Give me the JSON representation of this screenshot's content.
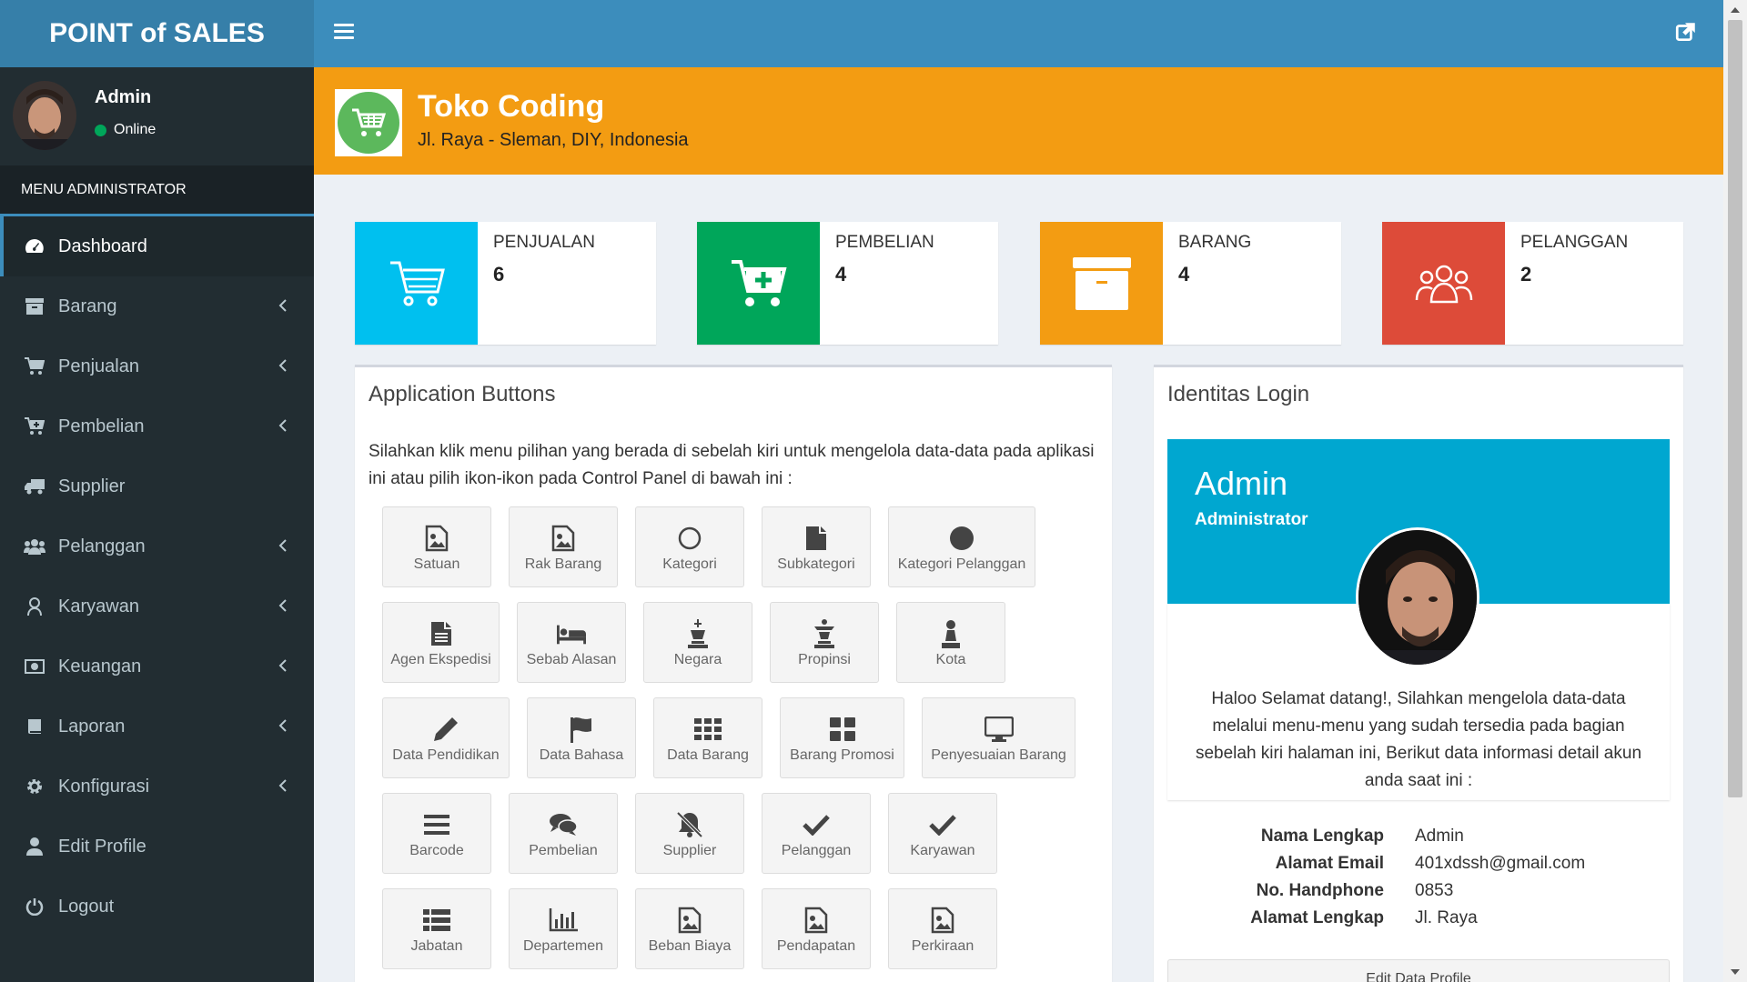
{
  "header": {
    "logo_text": "POINT of SALES"
  },
  "user": {
    "name": "Admin",
    "status": "Online"
  },
  "sidebar": {
    "header": "MENU ADMINISTRATOR",
    "items": [
      {
        "label": "Dashboard",
        "icon": "dashboard-icon",
        "has_chevron": false,
        "active": true
      },
      {
        "label": "Barang",
        "icon": "archive-icon",
        "has_chevron": true
      },
      {
        "label": "Penjualan",
        "icon": "cart-icon",
        "has_chevron": true
      },
      {
        "label": "Pembelian",
        "icon": "cart-plus-icon",
        "has_chevron": true
      },
      {
        "label": "Supplier",
        "icon": "truck-icon",
        "has_chevron": false
      },
      {
        "label": "Pelanggan",
        "icon": "users-icon",
        "has_chevron": true
      },
      {
        "label": "Karyawan",
        "icon": "user-secret-icon",
        "has_chevron": true
      },
      {
        "label": "Keuangan",
        "icon": "money-icon",
        "has_chevron": true
      },
      {
        "label": "Laporan",
        "icon": "book-icon",
        "has_chevron": true
      },
      {
        "label": "Konfigurasi",
        "icon": "gear-icon",
        "has_chevron": true
      },
      {
        "label": "Edit Profile",
        "icon": "user-icon",
        "has_chevron": false
      },
      {
        "label": "Logout",
        "icon": "power-icon",
        "has_chevron": false
      }
    ]
  },
  "store": {
    "name": "Toko Coding",
    "address": "Jl. Raya - Sleman, DIY, Indonesia"
  },
  "info_boxes": [
    {
      "label": "PENJUALAN",
      "value": "6",
      "color": "#00c0ef"
    },
    {
      "label": "PEMBELIAN",
      "value": "4",
      "color": "#00a65a"
    },
    {
      "label": "BARANG",
      "value": "4",
      "color": "#f39c12"
    },
    {
      "label": "PELANGGAN",
      "value": "2",
      "color": "#dd4b39"
    }
  ],
  "app_panel": {
    "title": "Application Buttons",
    "description": "Silahkan klik menu pilihan yang berada di sebelah kiri untuk mengelola data-data pada aplikasi ini atau pilih ikon-ikon pada Control Panel di bawah ini :",
    "buttons": [
      {
        "label": "Satuan",
        "icon": "image-icon"
      },
      {
        "label": "Rak Barang",
        "icon": "image-icon"
      },
      {
        "label": "Kategori",
        "icon": "circle-outline-icon"
      },
      {
        "label": "Subkategori",
        "icon": "file-icon"
      },
      {
        "label": "Kategori Pelanggan",
        "icon": "circle-icon"
      },
      {
        "label": "Agen Ekspedisi",
        "icon": "file-text-icon"
      },
      {
        "label": "Sebab Alasan",
        "icon": "bed-icon"
      },
      {
        "label": "Negara",
        "icon": "chess-king-icon"
      },
      {
        "label": "Propinsi",
        "icon": "chess-queen-icon"
      },
      {
        "label": "Kota",
        "icon": "chess-pawn-icon"
      },
      {
        "label": "Data Pendidikan",
        "icon": "pencil-icon"
      },
      {
        "label": "Data Bahasa",
        "icon": "flag-icon"
      },
      {
        "label": "Data Barang",
        "icon": "grid-icon"
      },
      {
        "label": "Barang Promosi",
        "icon": "th-large-icon"
      },
      {
        "label": "Penyesuaian Barang",
        "icon": "desktop-icon"
      },
      {
        "label": "Barcode",
        "icon": "bars-icon"
      },
      {
        "label": "Pembelian",
        "icon": "comments-icon"
      },
      {
        "label": "Supplier",
        "icon": "bell-slash-icon"
      },
      {
        "label": "Pelanggan",
        "icon": "check-icon"
      },
      {
        "label": "Karyawan",
        "icon": "check-icon"
      },
      {
        "label": "Jabatan",
        "icon": "list-icon"
      },
      {
        "label": "Departemen",
        "icon": "bar-chart-icon"
      },
      {
        "label": "Beban Biaya",
        "icon": "image-icon"
      },
      {
        "label": "Pendapatan",
        "icon": "image-icon"
      },
      {
        "label": "Perkiraan",
        "icon": "image-icon"
      }
    ]
  },
  "login_panel": {
    "title": "Identitas Login",
    "widget_name": "Admin",
    "widget_role": "Administrator",
    "message": "Haloo Selamat datang!, Silahkan mengelola data-data melalui menu-menu yang sudah tersedia pada bagian sebelah kiri halaman ini, Berikut data informasi detail akun anda saat ini :",
    "fields": [
      {
        "label": "Nama Lengkap",
        "value": "Admin"
      },
      {
        "label": "Alamat Email",
        "value": "401xdssh@gmail.com"
      },
      {
        "label": "No. Handphone",
        "value": "0853"
      },
      {
        "label": "Alamat Lengkap",
        "value": "Jl. Raya"
      }
    ],
    "edit_button": "Edit Data Profile"
  }
}
